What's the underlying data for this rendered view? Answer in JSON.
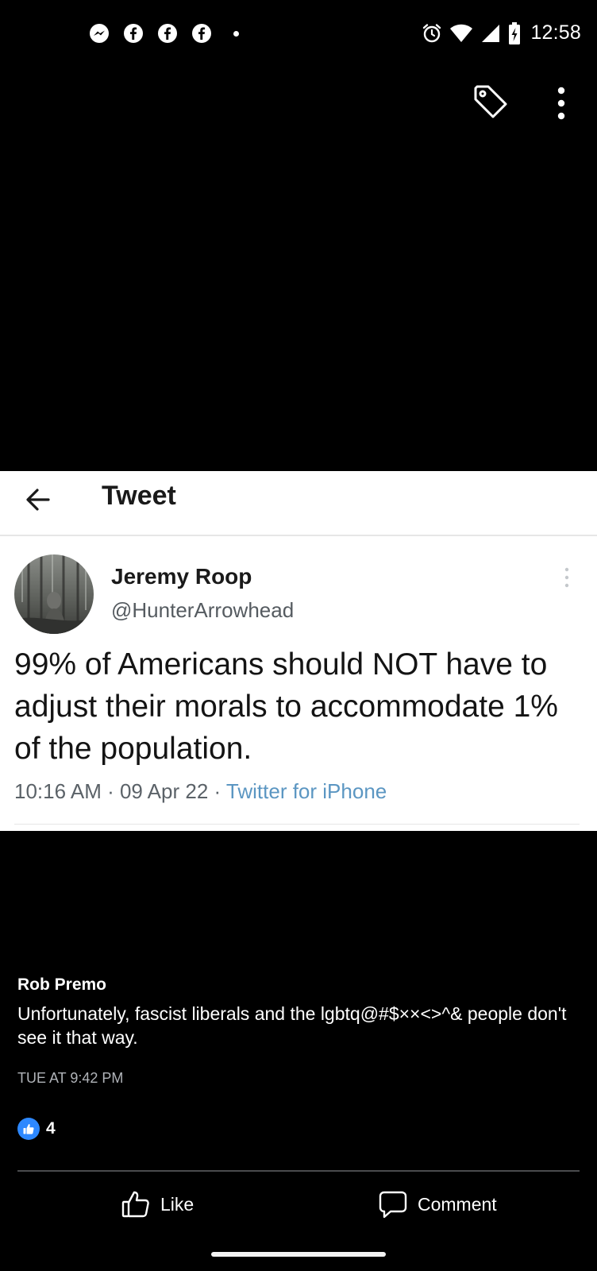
{
  "status_bar": {
    "time": "12:58",
    "notification_icons": [
      "messenger-icon",
      "facebook-icon",
      "facebook-icon",
      "facebook-icon"
    ],
    "system_icons": [
      "alarm-icon",
      "wifi-icon",
      "cell-signal-icon",
      "battery-charging-icon"
    ]
  },
  "toolbar": {
    "icons": [
      "tag-icon",
      "more-vertical-icon"
    ]
  },
  "tweet": {
    "header_title": "Tweet",
    "author_name": "Jeremy Roop",
    "author_handle": "@HunterArrowhead",
    "text": "99% of Americans should NOT have to adjust their morals to accommodate 1% of the population.",
    "time": "10:16 AM",
    "date": "09 Apr 22",
    "separator": " · ",
    "source": "Twitter for iPhone",
    "colors": {
      "source_link": "#5b96c2"
    }
  },
  "comment": {
    "author": "Rob Premo",
    "text": "Unfortunately, fascist liberals and the lgbtq@#$××<>^& people don't see it that way.",
    "timestamp": "TUE AT 9:42 PM",
    "reaction_count": "4",
    "colors": {
      "like_badge": "#2d88ff"
    }
  },
  "actions": {
    "like_label": "Like",
    "comment_label": "Comment"
  }
}
